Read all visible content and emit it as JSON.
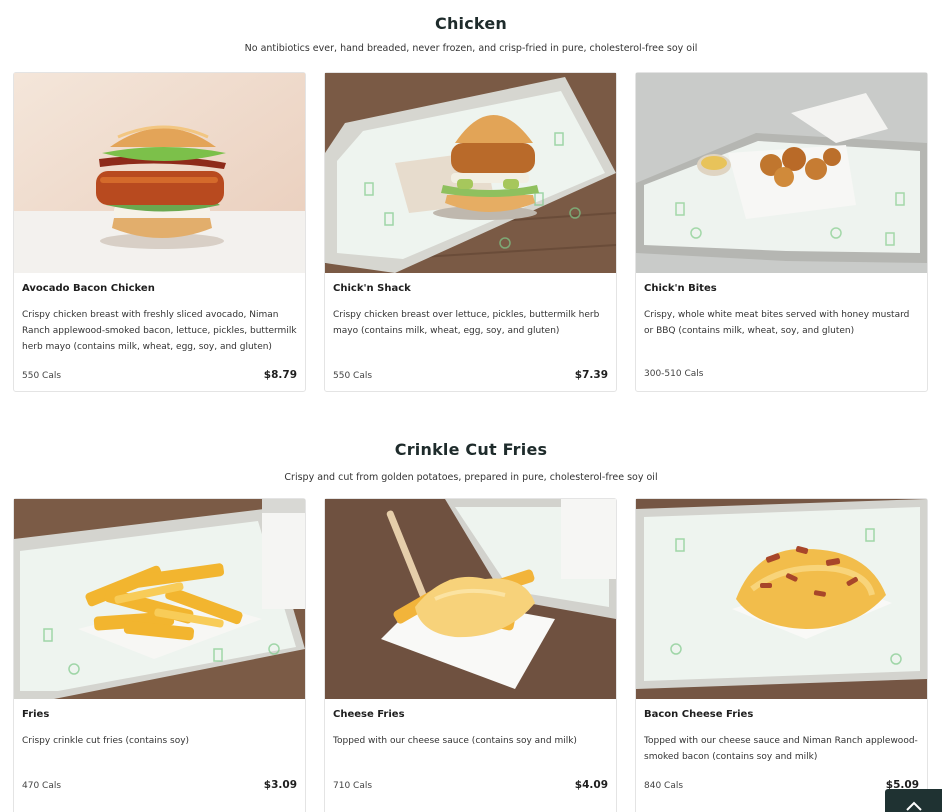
{
  "sections": [
    {
      "title": "Chicken",
      "subtitle": "No antibiotics ever, hand breaded, never frozen, and crisp-fried in pure, cholesterol-free soy oil",
      "items": [
        {
          "name": "Avocado Bacon Chicken",
          "description": "Crispy chicken breast with freshly sliced avocado, Niman Ranch applewood-smoked bacon, lettuce, pickles, buttermilk herb mayo (contains milk, wheat, egg, soy, and gluten)",
          "cals": "550 Cals",
          "price": "$8.79"
        },
        {
          "name": "Chick'n Shack",
          "description": "Crispy chicken breast over lettuce, pickles, buttermilk herb mayo (contains milk, wheat, egg, soy, and gluten)",
          "cals": "550 Cals",
          "price": "$7.39"
        },
        {
          "name": "Chick'n Bites",
          "description": "Crispy, whole white meat bites served with honey mustard or BBQ (contains milk, wheat, soy, and gluten)",
          "cals": "300-510 Cals",
          "price": ""
        }
      ]
    },
    {
      "title": "Crinkle Cut Fries",
      "subtitle": "Crispy and cut from golden potatoes, prepared in pure, cholesterol-free soy oil",
      "items": [
        {
          "name": "Fries",
          "description": "Crispy crinkle cut fries (contains soy)",
          "cals": "470 Cals",
          "price": "$3.09"
        },
        {
          "name": "Cheese Fries",
          "description": "Topped with our cheese sauce (contains soy and milk)",
          "cals": "710 Cals",
          "price": "$4.09"
        },
        {
          "name": "Bacon Cheese Fries",
          "description": "Topped with our cheese sauce and Niman Ranch applewood-smoked bacon (contains soy and milk)",
          "cals": "840 Cals",
          "price": "$5.09"
        }
      ]
    }
  ],
  "icons": {
    "scroll_top": "chevron-up-icon"
  },
  "colors": {
    "heading": "#1e2b2b",
    "scroll_button": "#1f3232",
    "brand_green": "#6fbf73"
  }
}
